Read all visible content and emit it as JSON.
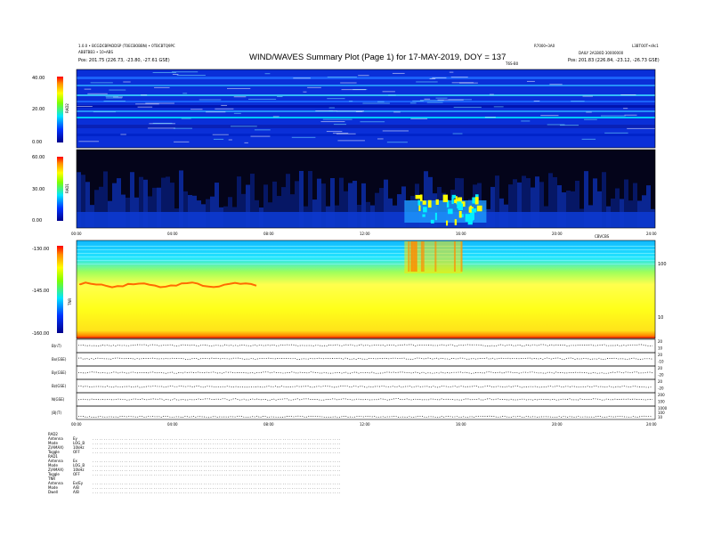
{
  "header": {
    "title": "WIND/WAVES Summary Plot (Page 1) for 17-MAY-2019, DOY = 137",
    "left_line1": "1.0.0 • BCGDCBPADDSP (T0ECBOBBN) • 0TBCBTQ9PC",
    "left_line2": "ABBTBB3 • 10•ABS",
    "left_line3": "Pos: 201.75 (226.73, -23.80, -27.61 GSE)",
    "center_right": "R7000•3A0",
    "right_line1": "L3BTO0T•s9c1",
    "right_line2": "DAILY 2A1B0D 30000000",
    "right_line3": "Pos: 201.83 (226.84, -23.12, -26.73 GSE)",
    "rad1_hint": "T6S-B0",
    "tnr_hint": "CBVCBS"
  },
  "colors": {
    "dark_blue": "#00008b",
    "blue": "#0033ff",
    "cyan": "#00e5ff",
    "yellow": "#ffff00",
    "orange": "#ff8c00",
    "red": "#ff0000"
  },
  "chart_data": [
    {
      "type": "heatmap",
      "name": "RAD2",
      "ylabel": "RAD2",
      "yticks": [
        "40.00",
        "20.00",
        "0.00"
      ],
      "xlim": [
        0,
        24
      ],
      "colorbar": "dark-blue to red"
    },
    {
      "type": "heatmap",
      "name": "RAD1",
      "ylabel": "RAD1",
      "yticks": [
        "60.00",
        "30.00",
        "0.00"
      ],
      "xlim": [
        0,
        24
      ],
      "colorbar": "dark-blue to red",
      "activity": [
        {
          "start_hour": 13.6,
          "end_hour": 17.0,
          "level": "high"
        }
      ]
    },
    {
      "type": "heatmap",
      "name": "TNR",
      "ylabel": "TNR",
      "yticks": [
        "-130.00",
        "-145.00",
        "-160.00"
      ],
      "right_yticks": [
        "100",
        "10"
      ],
      "xlim": [
        0,
        24
      ],
      "xticks": [
        "00:00",
        "04:00",
        "08:00",
        "12:00",
        "16:00",
        "20:00",
        "24:00"
      ],
      "colorbar": "dark-blue to red"
    },
    {
      "type": "line",
      "name": "Magnetometer",
      "panels": [
        {
          "label": "B(nT)",
          "right_ticks": [
            "20",
            "10"
          ],
          "level": 0.55
        },
        {
          "label": "Bx(GSE)",
          "right_ticks": [
            "20",
            "-10"
          ],
          "level": 0.55
        },
        {
          "label": "By(GSE)",
          "right_ticks": [
            "20",
            "-20"
          ],
          "level": 0.5
        },
        {
          "label": "Bz(GSE)",
          "right_ticks": [
            "20",
            "-20"
          ],
          "level": 0.45
        },
        {
          "label": "N(GSE)",
          "right_ticks": [
            "200",
            "100"
          ],
          "level": 0.5
        },
        {
          "label": "|B|(T)",
          "right_ticks": [
            "1000",
            "100",
            "10"
          ],
          "level": 0.2
        }
      ],
      "xticks": [
        "00:00",
        "04:00",
        "08:00",
        "12:00",
        "16:00",
        "20:00",
        "24:00"
      ]
    }
  ],
  "footer": {
    "blocks": [
      {
        "name": "RAD2",
        "rows": [
          {
            "label": "Antenna",
            "value": "Ey"
          },
          {
            "label": "Mode",
            "value": "LOG_B"
          },
          {
            "label": "Z(AMAX)",
            "value": "10kHz"
          },
          {
            "label": "Toggle",
            "value": "OFF"
          }
        ]
      },
      {
        "name": "RAD1",
        "rows": [
          {
            "label": "Antenna",
            "value": "Ex"
          },
          {
            "label": "Mode",
            "value": "LOG_B"
          },
          {
            "label": "Z(AMAX)",
            "value": "10kHz"
          },
          {
            "label": "Toggle",
            "value": "OFF"
          }
        ]
      },
      {
        "name": "TNR",
        "rows": [
          {
            "label": "Antenna",
            "value": "Ex/Ey"
          },
          {
            "label": "Mode",
            "value": "A/B"
          },
          {
            "label": "Dwell",
            "value": "A/B"
          }
        ]
      }
    ]
  }
}
